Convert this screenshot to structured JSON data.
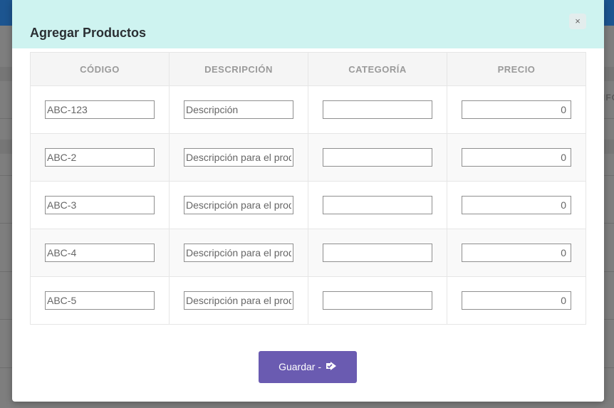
{
  "background": {
    "side_fragment": "IFC"
  },
  "modal": {
    "title": "Agregar Productos",
    "close_glyph": "×",
    "columns": [
      "CÓDIGO",
      "DESCRIPCIÓN",
      "CATEGORÍA",
      "PRECIO"
    ],
    "rows": [
      {
        "codigo": "ABC-123",
        "descripcion": "Descripción",
        "categoria": "",
        "precio": "0"
      },
      {
        "codigo": "ABC-2",
        "descripcion": "Descripción para el prod",
        "categoria": "",
        "precio": "0"
      },
      {
        "codigo": "ABC-3",
        "descripcion": "Descripción para el prod",
        "categoria": "",
        "precio": "0"
      },
      {
        "codigo": "ABC-4",
        "descripcion": "Descripción para el prod",
        "categoria": "",
        "precio": "0"
      },
      {
        "codigo": "ABC-5",
        "descripcion": "Descripción para el prod",
        "categoria": "",
        "precio": "0"
      }
    ],
    "save_label": "Guardar - ",
    "save_icon": "share-check-icon"
  },
  "colors": {
    "header_bg": "#cef3f0",
    "save_button": "#6a5bb1",
    "topbar": "#1c5590"
  }
}
